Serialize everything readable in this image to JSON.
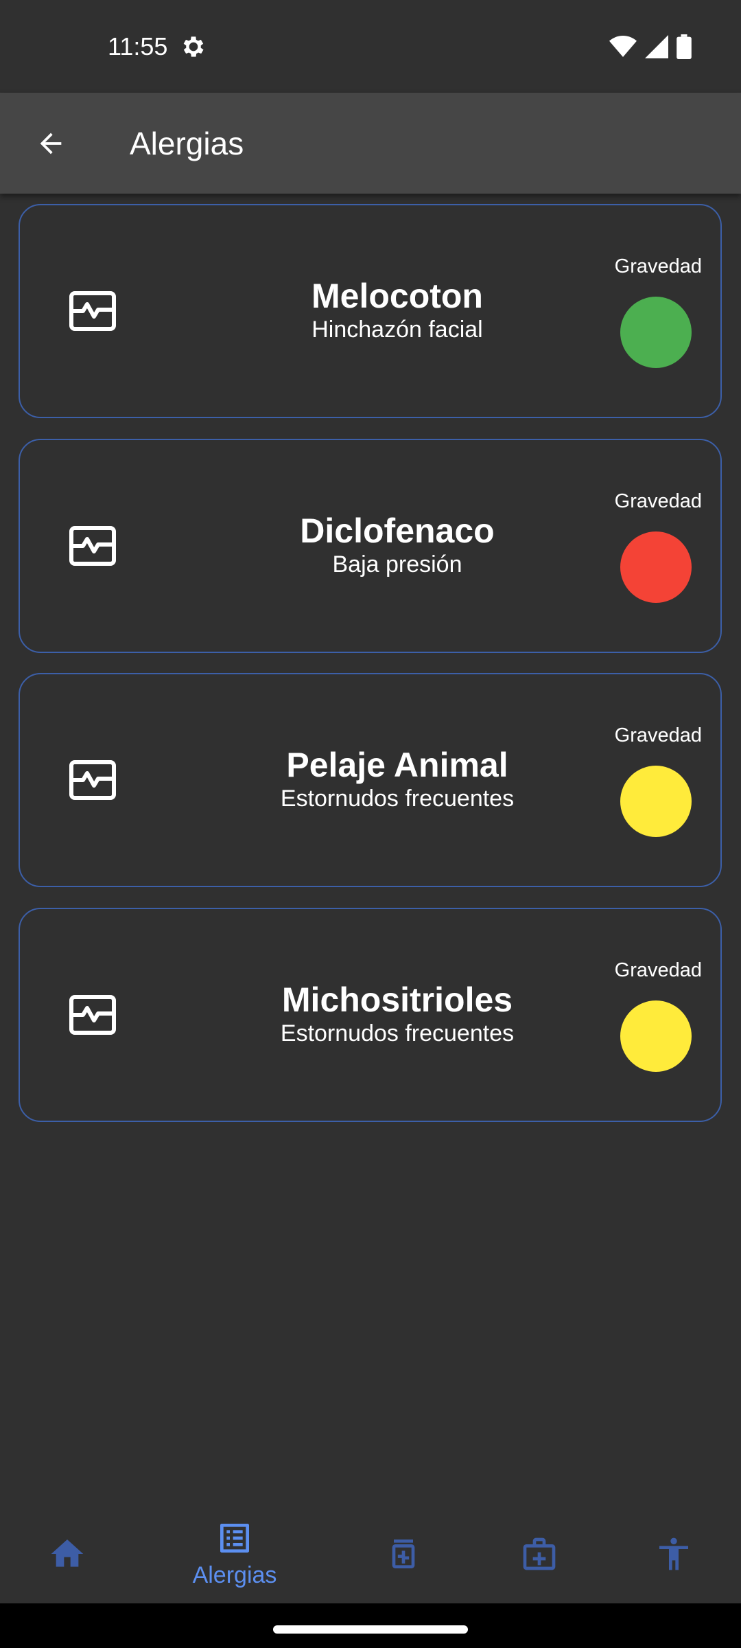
{
  "status_bar": {
    "time": "11:55",
    "icons": [
      "gear-icon",
      "wifi-icon",
      "signal-icon",
      "battery-icon"
    ]
  },
  "app_bar": {
    "title": "Alergias",
    "back_icon": "arrow-back-icon"
  },
  "severity_label": "Gravedad",
  "colors": {
    "background": "#303030",
    "app_bar": "#464646",
    "card_border": "#3c5fa8",
    "accent": "#5c8ff0",
    "nav_inactive": "#3d5da6",
    "severity_green": "#4caf50",
    "severity_red": "#f44336",
    "severity_yellow": "#ffeb3b"
  },
  "allergies": [
    {
      "name": "Melocoton",
      "symptom": "Hinchazón facial",
      "severity_color": "#4caf50",
      "icon": "monitor-heart-icon"
    },
    {
      "name": "Diclofenaco",
      "symptom": "Baja presión",
      "severity_color": "#f44336",
      "icon": "monitor-heart-icon"
    },
    {
      "name": "Pelaje Animal",
      "symptom": "Estornudos frecuentes",
      "severity_color": "#ffeb3b",
      "icon": "monitor-heart-icon"
    },
    {
      "name": "Michositrioles",
      "symptom": "Estornudos frecuentes",
      "severity_color": "#ffeb3b",
      "icon": "monitor-heart-icon"
    }
  ],
  "bottom_nav": {
    "items": [
      {
        "icon": "home-icon",
        "label": "",
        "active": false
      },
      {
        "icon": "list-icon",
        "label": "Alergias",
        "active": true
      },
      {
        "icon": "medication-icon",
        "label": "",
        "active": false
      },
      {
        "icon": "medical-case-icon",
        "label": "",
        "active": false
      },
      {
        "icon": "accessibility-icon",
        "label": "",
        "active": false
      }
    ]
  }
}
